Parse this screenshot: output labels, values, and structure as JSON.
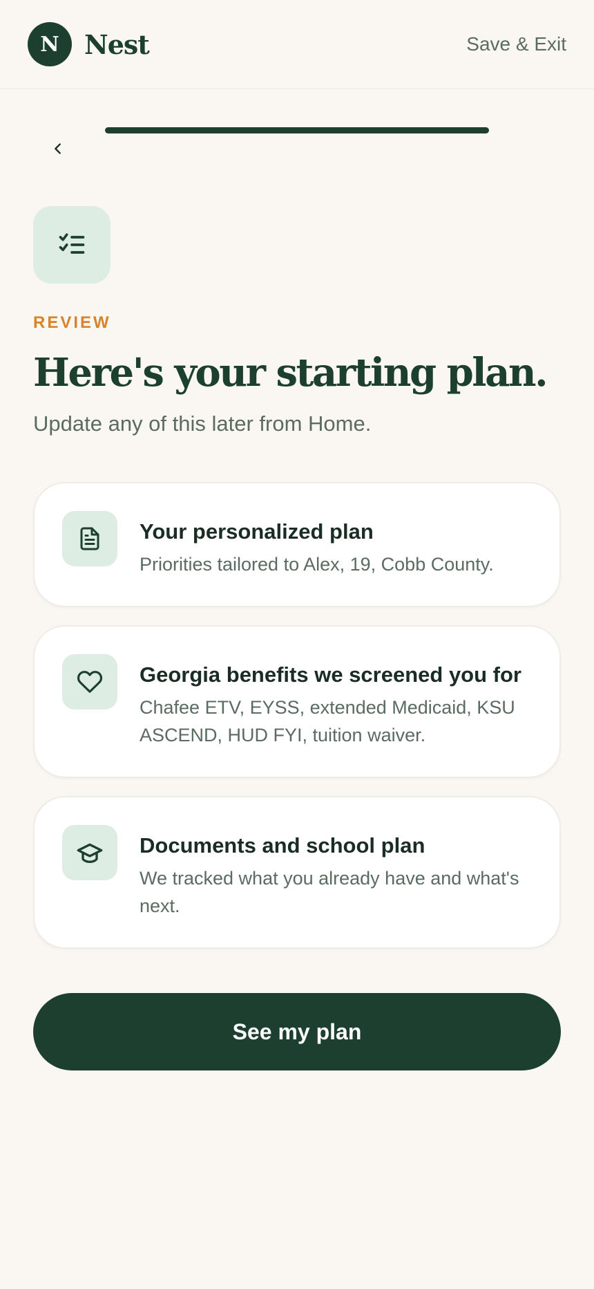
{
  "header": {
    "logo_letter": "N",
    "brand_name": "Nest",
    "save_exit_label": "Save & Exit"
  },
  "progress": {
    "fraction": 1.0
  },
  "step": {
    "eyebrow": "REVIEW",
    "title": "Here's your starting plan.",
    "subtitle": "Update any of this later from Home."
  },
  "cards": [
    {
      "icon": "document-icon",
      "title": "Your personalized plan",
      "description": "Priorities tailored to Alex, 19, Cobb County."
    },
    {
      "icon": "heart-icon",
      "title": "Georgia benefits we screened you for",
      "description": "Chafee ETV, EYSS, extended Medicaid, KSU ASCEND, HUD FYI, tuition waiver."
    },
    {
      "icon": "graduation-cap-icon",
      "title": "Documents and school plan",
      "description": "We tracked what you already have and what's next."
    }
  ],
  "cta_label": "See my plan",
  "colors": {
    "primary": "#1c3f2f",
    "accent": "#d6832a",
    "icon_bg": "#deede4",
    "background": "#faf7f3"
  }
}
